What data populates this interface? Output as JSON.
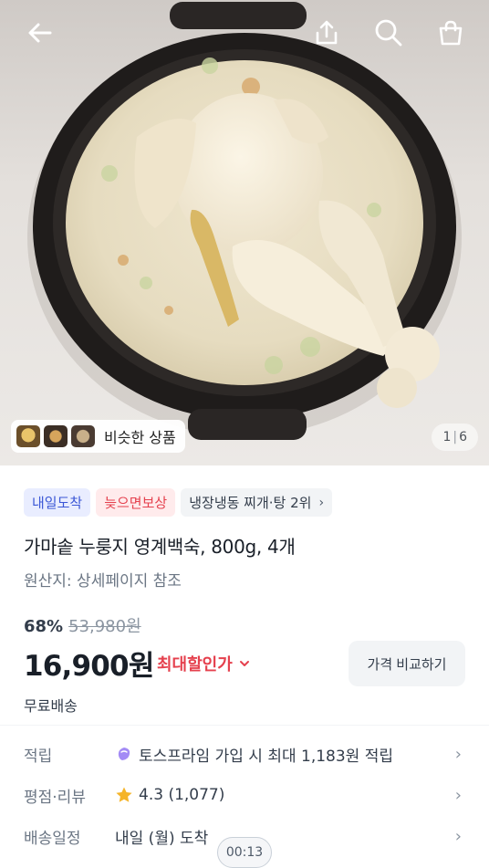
{
  "top_bar": {
    "back_icon": "arrow-left-icon",
    "share_icon": "share-upload-icon",
    "search_icon": "search-icon",
    "cart_icon": "shopping-bag-icon"
  },
  "hero": {
    "similar_label": "비슷한 상품",
    "pager_current": "1",
    "pager_total": "6"
  },
  "badges": {
    "tomorrow": "내일도착",
    "late_comp": "늦으면보상",
    "ranking": "냉장냉동 찌개·탕 2위"
  },
  "product": {
    "title": "가마솥 누룽지 영계백숙, 800g, 4개",
    "origin": "원산지: 상세페이지 참조",
    "discount_rate": "68%",
    "original_price": "53,980원",
    "price": "16,900원",
    "max_discount_label": "최대할인가",
    "compare_label": "가격 비교하기",
    "shipping": "무료배송"
  },
  "rows": {
    "points_key": "적립",
    "points_value": "토스프라임 가입 시 최대 1,183원 적립",
    "rating_key": "평점·리뷰",
    "rating_value": "4.3 (1,077)",
    "delivery_key": "배송일정",
    "delivery_value": "내일 (월) 도착"
  },
  "video_timer": "00:13",
  "colors": {
    "accent_red": "#e5414e",
    "accent_blue": "#3b57d6",
    "star": "#f5b428"
  }
}
